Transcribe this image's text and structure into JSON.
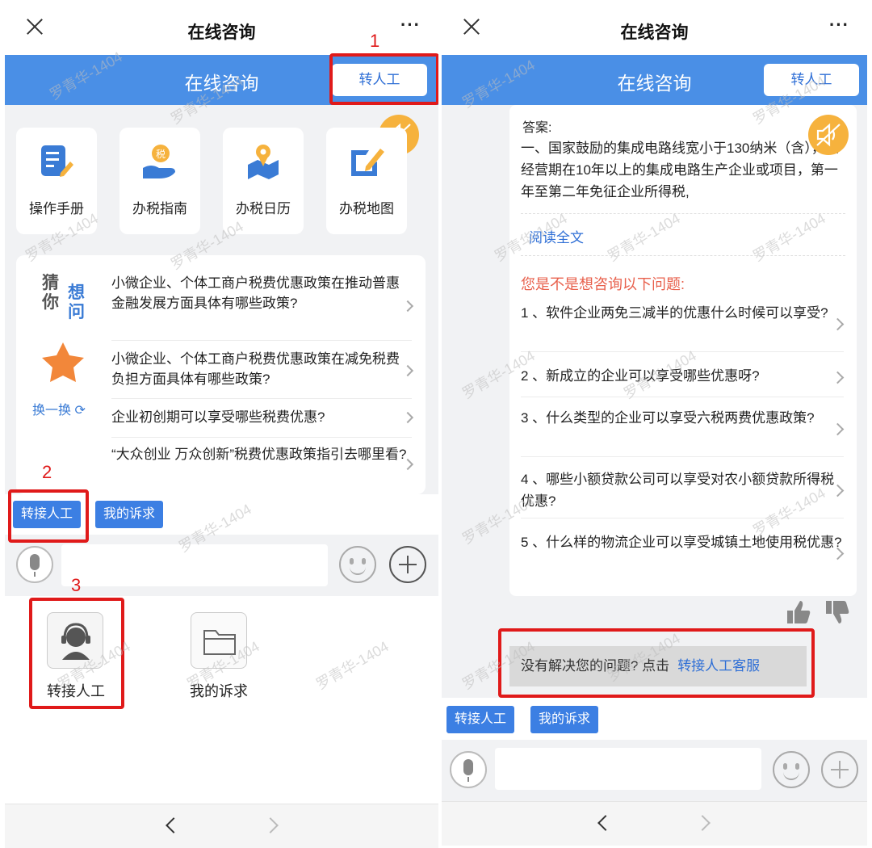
{
  "left": {
    "topbar": {
      "title": "在线咨询",
      "more": "···"
    },
    "header": {
      "title": "在线咨询",
      "transfer_label": "转人工"
    },
    "tools": [
      {
        "label": "操作手册",
        "icon": "manual-icon"
      },
      {
        "label": "办税指南",
        "icon": "tax-guide-icon"
      },
      {
        "label": "办税日历",
        "icon": "tax-calendar-icon"
      },
      {
        "label": "办税地图",
        "icon": "tax-map-icon"
      }
    ],
    "guess": {
      "cai": "猜",
      "ni": "你",
      "xiang": "想",
      "wen": "问",
      "swap_label": "换一换 ⟳",
      "questions": [
        "小微企业、个体工商户税费优惠政策在推动普惠金融发展方面具体有哪些政策?",
        "小微企业、个体工商户税费优惠政策在减免税费负担方面具体有哪些政策?",
        "企业初创期可以享受哪些税费优惠?",
        "“大众创业 万众创新”税费优惠政策指引去哪里看?"
      ]
    },
    "quick_buttons": [
      "转接人工",
      "我的诉求"
    ],
    "ext": [
      {
        "label": "转接人工",
        "icon": "customer-service-icon"
      },
      {
        "label": "我的诉求",
        "icon": "folder-icon"
      }
    ],
    "annotations": [
      "1",
      "2",
      "3"
    ]
  },
  "right": {
    "topbar": {
      "title": "在线咨询",
      "more": "···"
    },
    "header": {
      "title": "在线咨询",
      "transfer_label": "转人工"
    },
    "answer_label": "答案:",
    "answer_text": "一、国家鼓励的集成电路线宽小于130纳米（含），且经营期在10年以上的集成电路生产企业或项目，第一年至第二年免征企业所得税,",
    "read_all": "阅读全文",
    "suggest_title": "您是不是想咨询以下问题:",
    "suggestions": [
      "1 、软件企业两免三减半的优惠什么时候可以享受?",
      "2 、新成立的企业可以享受哪些优惠呀?",
      "3 、什么类型的企业可以享受六税两费优惠政策?",
      "4 、哪些小额贷款公司可以享受对农小额贷款所得税优惠?",
      "5 、什么样的物流企业可以享受城镇土地使用税优惠?"
    ],
    "hint_text": "没有解决您的问题? 点击",
    "hint_link": "转接人工客服",
    "quick_buttons": [
      "转接人工",
      "我的诉求"
    ]
  },
  "watermark": "罗青华-1404",
  "colors": {
    "header_blue": "#4a8fe6",
    "button_blue": "#3c7fe3",
    "annotation_red": "#e01a1a",
    "mute_orange": "#f6b23d"
  }
}
